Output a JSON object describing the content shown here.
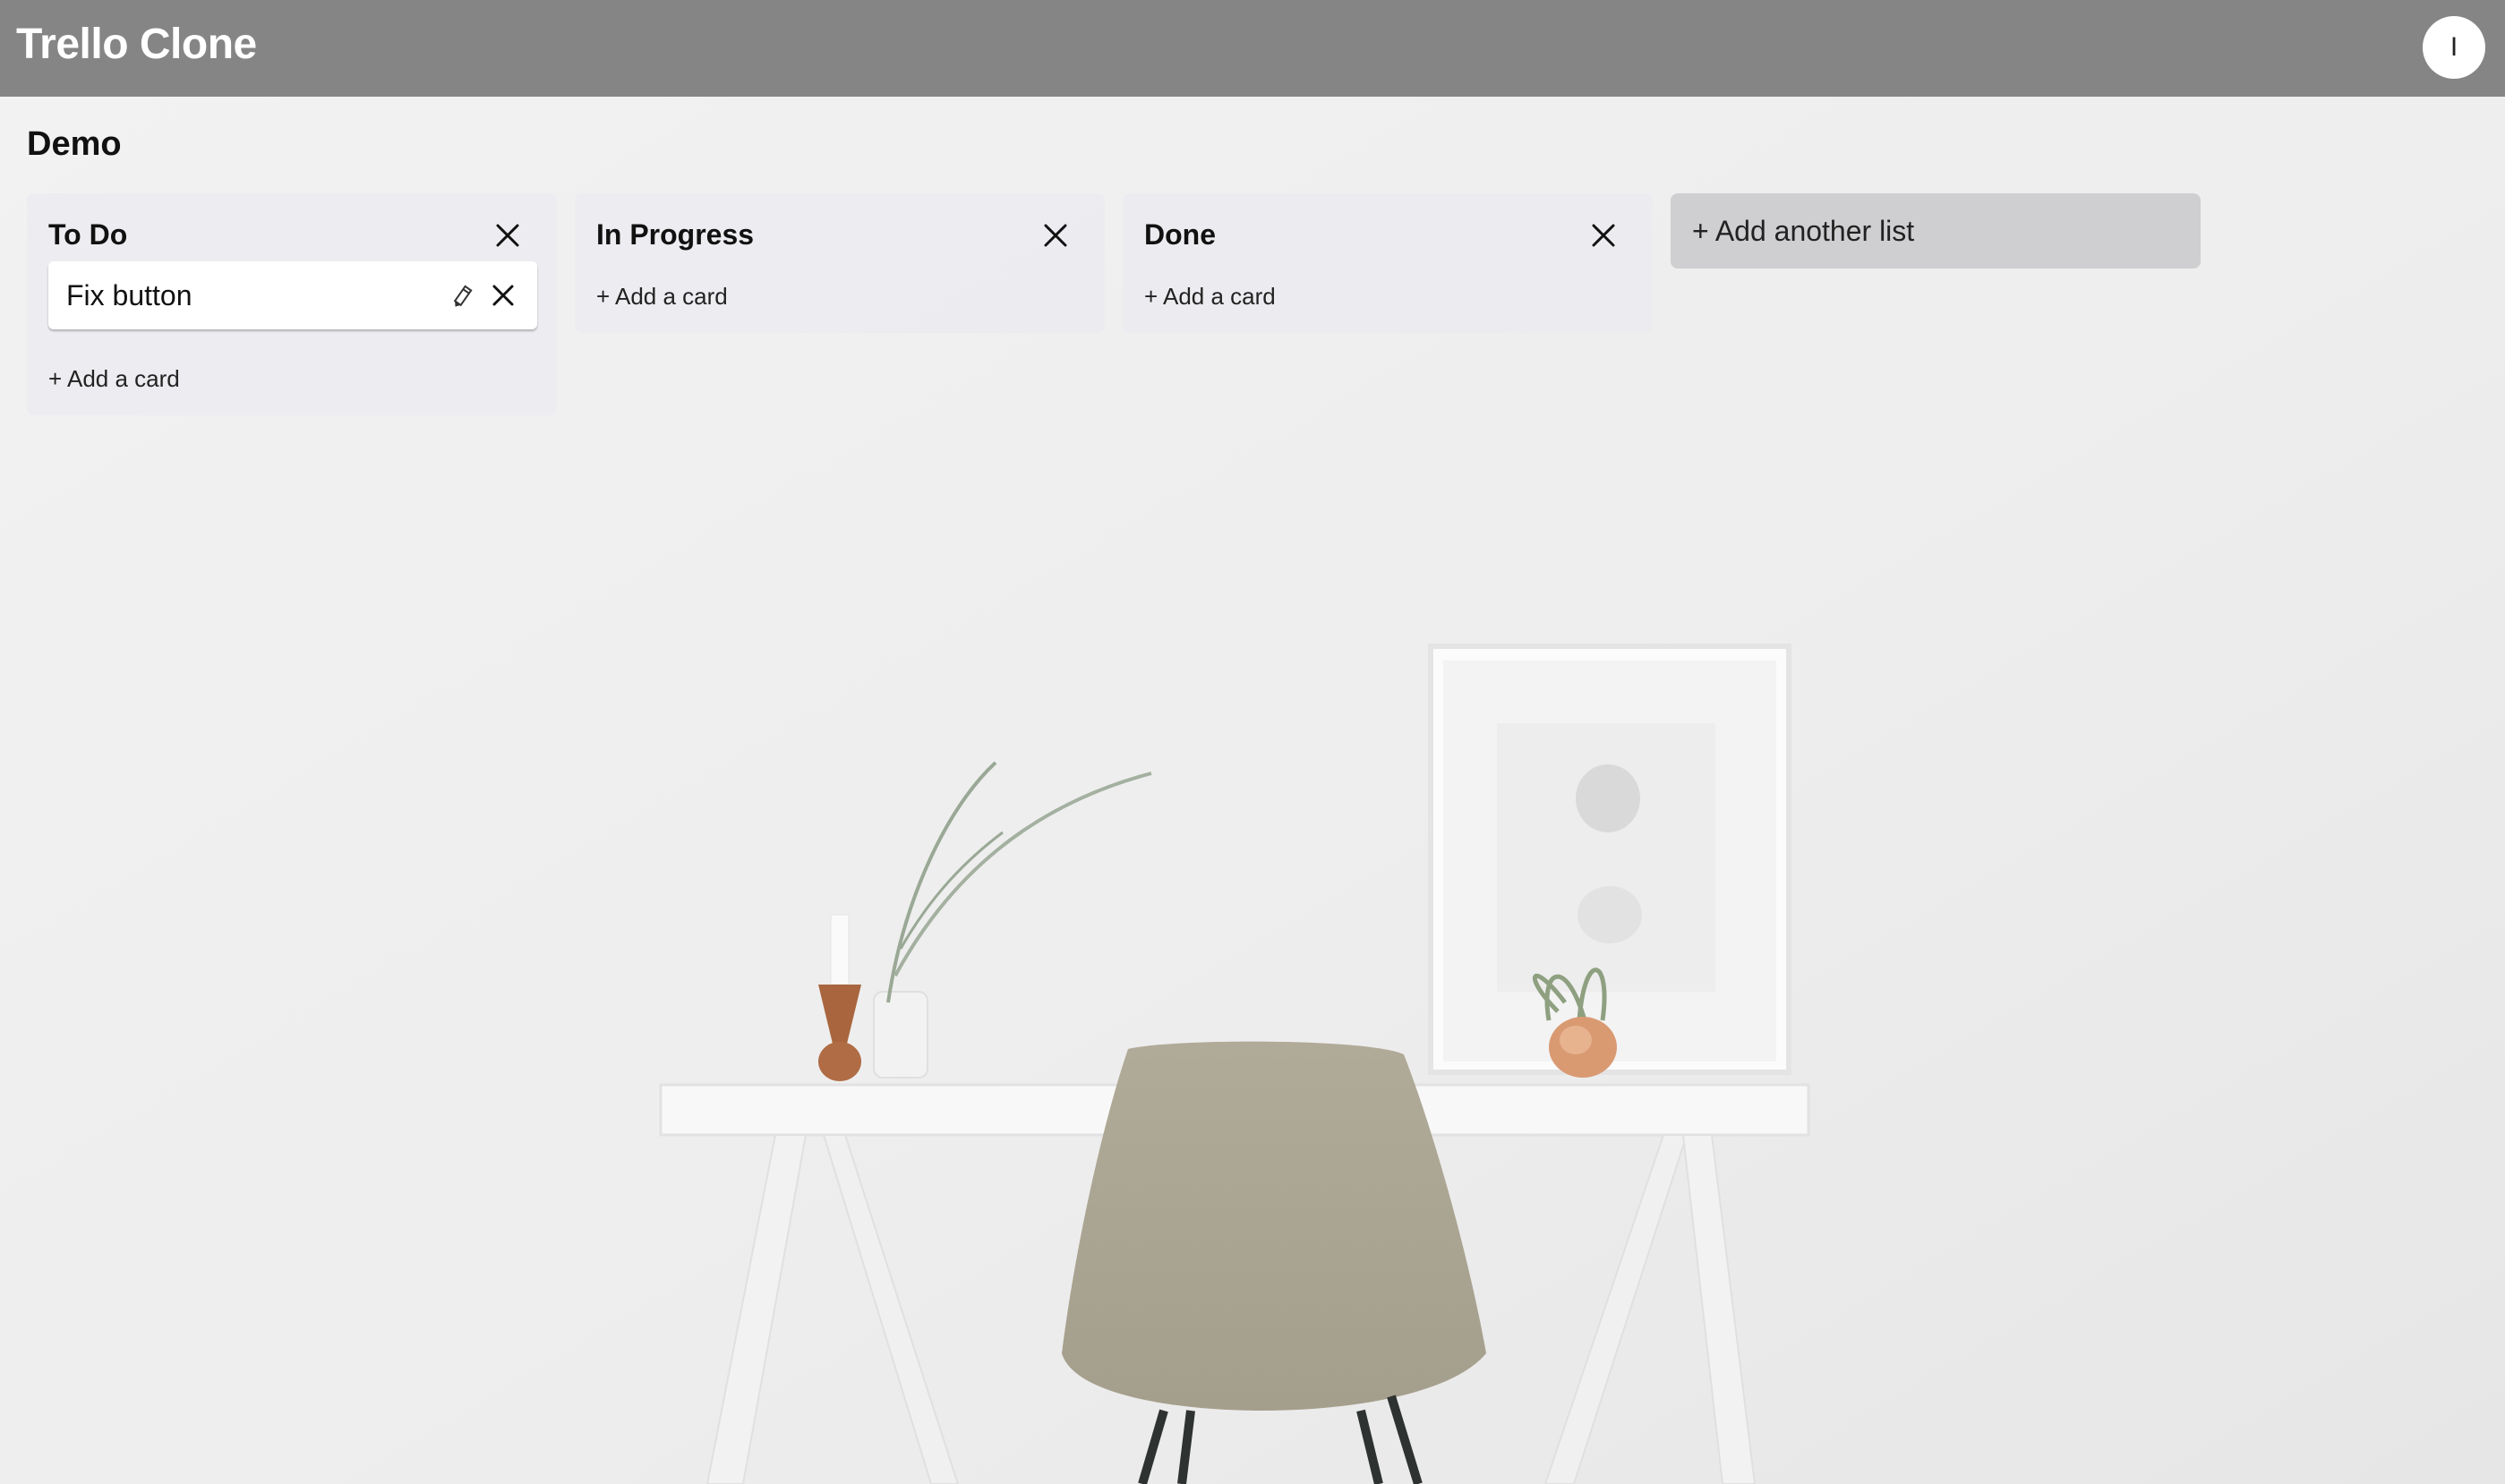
{
  "header": {
    "app_title": "Trello Clone",
    "avatar_initial": "I"
  },
  "board": {
    "title": "Demo",
    "lists": [
      {
        "title": "To Do",
        "cards": [
          {
            "text": "Fix button"
          }
        ],
        "add_card_label": "+ Add a card"
      },
      {
        "title": "In Progress",
        "cards": [],
        "add_card_label": "+ Add a card"
      },
      {
        "title": "Done",
        "cards": [],
        "add_card_label": "+ Add a card"
      }
    ],
    "add_list_label": "+ Add another list"
  },
  "icons": {
    "list_close": "close-icon",
    "card_edit": "pencil-icon",
    "card_delete": "close-icon"
  },
  "colors": {
    "header_bg": "#858585",
    "list_bg": "#ebecf0",
    "add_list_bg": "#cfcfd1",
    "card_bg": "#ffffff"
  }
}
